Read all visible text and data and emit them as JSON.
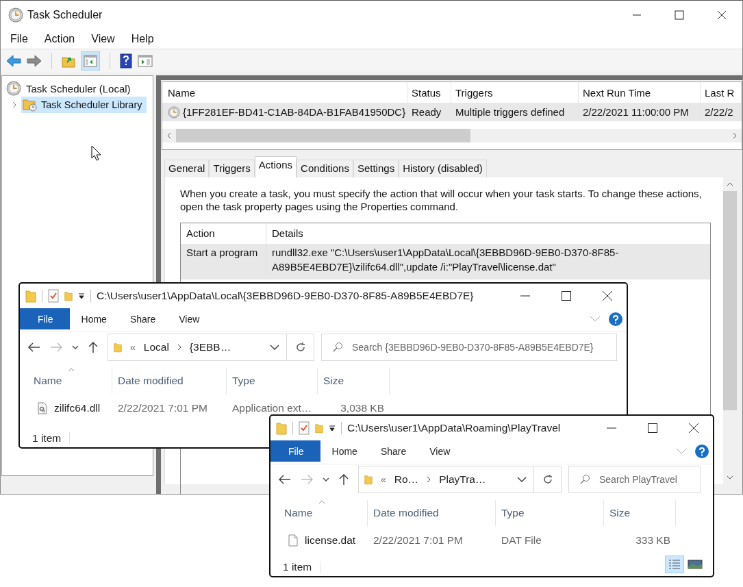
{
  "task_scheduler": {
    "title": "Task Scheduler",
    "menu": [
      "File",
      "Action",
      "View",
      "Help"
    ],
    "tree": [
      {
        "label": "Task Scheduler (Local)",
        "selected": false,
        "children": [
          {
            "label": "Task Scheduler Library",
            "selected": true,
            "expanded": false
          }
        ]
      }
    ],
    "task_list": {
      "columns": [
        "Name",
        "Status",
        "Triggers",
        "Next Run Time",
        "Last R"
      ],
      "rows": [
        {
          "cells": [
            "{1FF281EF-BD41-C1AB-84DA-B1FAB41950DC}",
            "Ready",
            "Multiple triggers defined",
            "2/22/2021 11:00:00 PM",
            "2/22/2"
          ],
          "selected": true
        }
      ]
    },
    "tabs": [
      {
        "label": "General",
        "selected": false
      },
      {
        "label": "Triggers",
        "selected": false
      },
      {
        "label": "Actions",
        "selected": true
      },
      {
        "label": "Conditions",
        "selected": false
      },
      {
        "label": "Settings",
        "selected": false
      },
      {
        "label": "History (disabled)",
        "selected": false
      }
    ],
    "description": "When you create a task, you must specify the action that will occur when your task starts.  To change these actions, open the task property pages using the Properties command.",
    "actions_table": {
      "columns": [
        "Action",
        "Details"
      ],
      "rows": [
        {
          "cells": [
            "Start a program",
            "rundll32.exe \"C:\\Users\\user1\\AppData\\Local\\{3EBBD96D-9EB0-D370-8F85-A89B5E4EBD7E}\\zilifc64.dll\",update /i:\"PlayTravel\\license.dat\""
          ]
        }
      ]
    }
  },
  "explorers": [
    {
      "path": "C:\\Users\\user1\\AppData\\Local\\{3EBBD96D-9EB0-D370-8F85-A89B5E4EBD7E}",
      "ribbon_tabs": [
        {
          "label": "File",
          "selected": true
        },
        {
          "label": "Home",
          "selected": false
        },
        {
          "label": "Share",
          "selected": false
        },
        {
          "label": "View",
          "selected": false
        }
      ],
      "overflow_marker": "«",
      "breadcrumb": [
        "Local",
        "{3EBB…"
      ],
      "search_placeholder": "Search {3EBBD96D-9EB0-D370-8F85-A89B5E4EBD7E}",
      "columns": [
        "Name",
        "Date modified",
        "Type",
        "Size"
      ],
      "files": [
        {
          "kind": "dll",
          "name": "zilifc64.dll",
          "date": "2/22/2021 7:01 PM",
          "type": "Application ext…",
          "size": "3,038 KB"
        }
      ],
      "status": "1 item"
    },
    {
      "path": "C:\\Users\\user1\\AppData\\Roaming\\PlayTravel",
      "ribbon_tabs": [
        {
          "label": "File",
          "selected": true
        },
        {
          "label": "Home",
          "selected": false
        },
        {
          "label": "Share",
          "selected": false
        },
        {
          "label": "View",
          "selected": false
        }
      ],
      "overflow_marker": "«",
      "breadcrumb": [
        "Ro…",
        "PlayTra…"
      ],
      "search_placeholder": "Search PlayTravel",
      "columns": [
        "Name",
        "Date modified",
        "Type",
        "Size"
      ],
      "files": [
        {
          "kind": "document",
          "name": "license.dat",
          "date": "2/22/2021 7:01 PM",
          "type": "DAT File",
          "size": "333 KB"
        }
      ],
      "status": "1 item",
      "view_buttons": [
        {
          "kind": "details",
          "selected": true
        },
        {
          "kind": "thumbnails",
          "selected": false
        }
      ]
    }
  ]
}
